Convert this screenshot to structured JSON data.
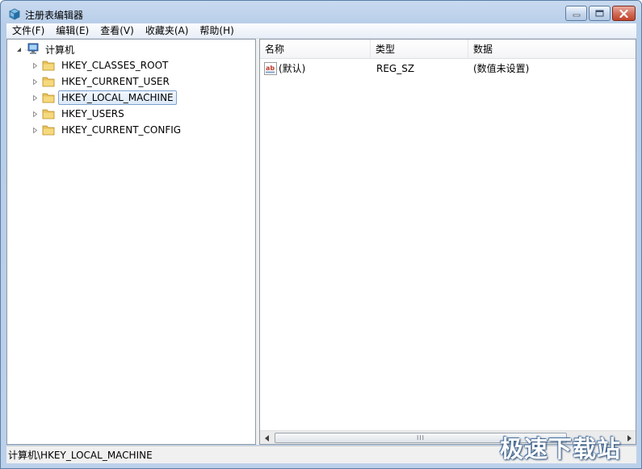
{
  "window": {
    "title": "注册表编辑器",
    "icon": "regedit-cube-icon",
    "controls": {
      "minimize": "minimize-icon",
      "maximize": "maximize-icon",
      "close": "close-icon"
    }
  },
  "menubar": {
    "items": [
      {
        "label": "文件(F)"
      },
      {
        "label": "编辑(E)"
      },
      {
        "label": "查看(V)"
      },
      {
        "label": "收藏夹(A)"
      },
      {
        "label": "帮助(H)"
      }
    ]
  },
  "tree": {
    "root": {
      "label": "计算机",
      "icon": "computer-icon",
      "expanded": true
    },
    "children": [
      {
        "label": "HKEY_CLASSES_ROOT",
        "selected": false
      },
      {
        "label": "HKEY_CURRENT_USER",
        "selected": false
      },
      {
        "label": "HKEY_LOCAL_MACHINE",
        "selected": true
      },
      {
        "label": "HKEY_USERS",
        "selected": false
      },
      {
        "label": "HKEY_CURRENT_CONFIG",
        "selected": false
      }
    ]
  },
  "list": {
    "columns": {
      "name": "名称",
      "type": "类型",
      "data": "数据"
    },
    "rows": [
      {
        "name": "(默认)",
        "type": "REG_SZ",
        "data": "(数值未设置)",
        "icon": "string-value-icon"
      }
    ],
    "scrollbar_grip": "III"
  },
  "statusbar": {
    "path": "计算机\\HKEY_LOCAL_MACHINE"
  },
  "watermark": {
    "text": "极速下载站"
  },
  "colors": {
    "selection_border": "#7da2ce",
    "folder": "#e8c25a",
    "close_button": "#c1442c"
  }
}
